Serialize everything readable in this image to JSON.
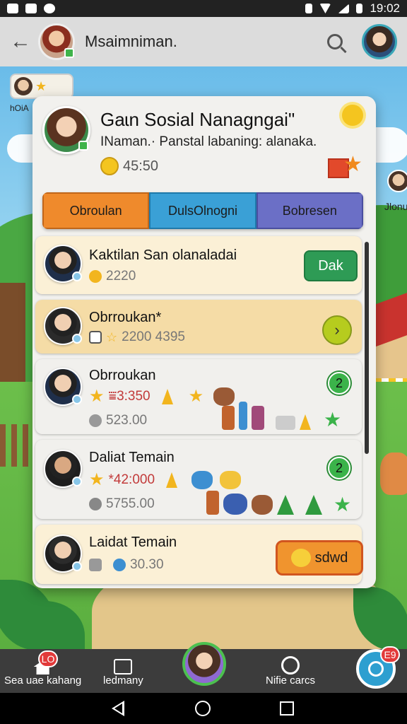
{
  "status_bar": {
    "time": "19:02"
  },
  "app_bar": {
    "title": "Msaimniman."
  },
  "floating": {
    "left_label": "hOiA",
    "right_label": "Jlonu"
  },
  "card": {
    "title": "Gaɩn Sosial Nanagngai\"",
    "subtitle": "INaman.· Panstal labaning: alanaka.",
    "points": "45:50"
  },
  "tabs": [
    {
      "label": "Obroulan"
    },
    {
      "label": "DulsOlnogni"
    },
    {
      "label": "Bobresen"
    }
  ],
  "rows": [
    {
      "name": "Kaktilan San olanaladai",
      "stat": "2220",
      "action": "Dak"
    },
    {
      "name": "Obrroukan*",
      "stat": "2200 4395"
    },
    {
      "name": "Obrroukan",
      "stat": "⩸3:350",
      "stat2": "523.00",
      "level": "2"
    },
    {
      "name": "Daliat Temain",
      "stat": "*42:000",
      "stat2": "5755.00",
      "level": "2"
    },
    {
      "name": "Laidat Temain",
      "stat": "30.30",
      "action": "sdwd"
    }
  ],
  "bottom_nav": {
    "home_label": "Sea uae kahang",
    "home_badge": "LO",
    "friends_label": "ledmany",
    "chat_label": "Nifie carcs",
    "fab_badge": "E9"
  },
  "colors": {
    "tab_1": "#ef8a2c",
    "tab_2": "#3aa0d6",
    "tab_3": "#6b6fc6",
    "accent_green": "#2e9b55",
    "row_highlight": "#fbf0d6"
  }
}
